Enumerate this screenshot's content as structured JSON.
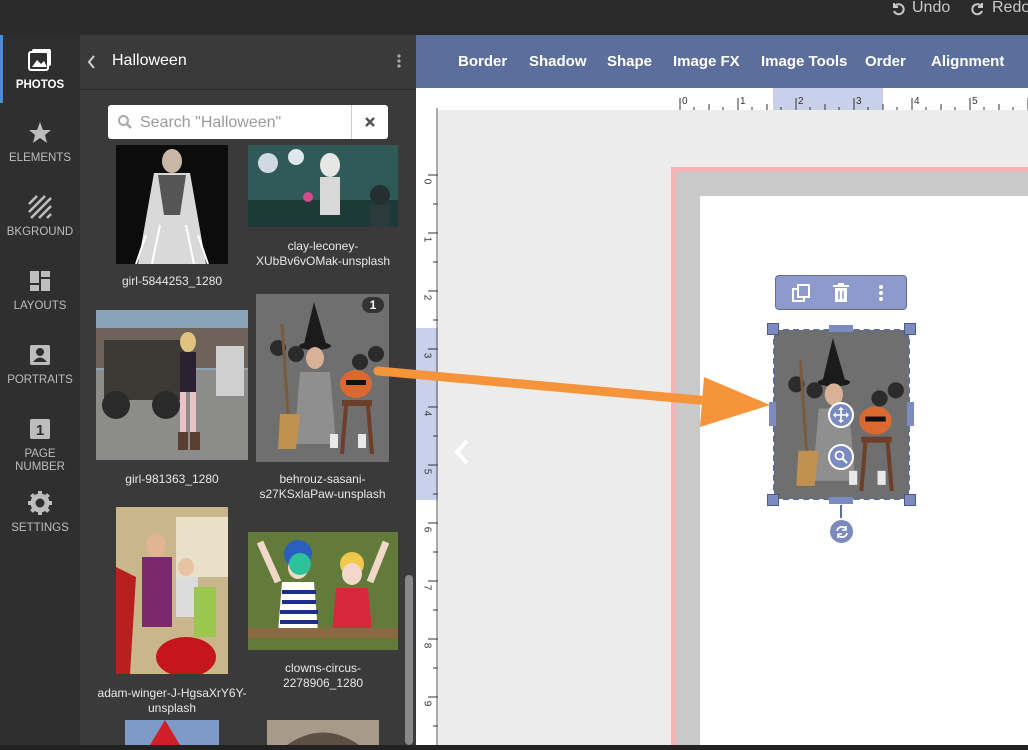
{
  "topbar": {
    "undo_label": "Undo",
    "redo_label": "Redo"
  },
  "rail": {
    "items": [
      {
        "label": "PHOTOS",
        "icon": "photos-icon"
      },
      {
        "label": "ELEMENTS",
        "icon": "star-icon"
      },
      {
        "label": "BKGROUND",
        "icon": "background-icon"
      },
      {
        "label": "LAYOUTS",
        "icon": "layouts-icon"
      },
      {
        "label": "PORTRAITS",
        "icon": "portrait-icon"
      },
      {
        "label": "PAGE NUMBER",
        "icon": "page-number-icon",
        "glyph": "1"
      },
      {
        "label": "SETTINGS",
        "icon": "gear-icon"
      }
    ]
  },
  "panel": {
    "title": "Halloween",
    "search": {
      "placeholder": "Search \"Halloween\"",
      "value": ""
    },
    "photos": [
      {
        "caption": "girl-5844253_1280"
      },
      {
        "caption": "clay-leconey-XUbBv6vOMak-unsplash"
      },
      {
        "caption": "girl-981363_1280"
      },
      {
        "caption": "behrouz-sasani-s27KSxlaPaw-unsplash",
        "badge": "1"
      },
      {
        "caption": "adam-winger-J-HgsaXrY6Y-unsplash"
      },
      {
        "caption": "clowns-circus-2278906_1280"
      }
    ]
  },
  "toolbar": {
    "items": [
      "Border",
      "Shadow",
      "Shape",
      "Image FX",
      "Image Tools",
      "Order",
      "Alignment"
    ]
  },
  "ruler": {
    "top": [
      "0",
      "1",
      "2",
      "3",
      "4",
      "5"
    ],
    "left": [
      "0",
      "1",
      "2",
      "3",
      "4",
      "5",
      "6",
      "7",
      "8",
      "9"
    ]
  },
  "colors": {
    "toolbar": "#5b6e9c",
    "selection": "#7b8bc0",
    "arrow": "#f5943a",
    "page_border": "#f7b3b3"
  }
}
